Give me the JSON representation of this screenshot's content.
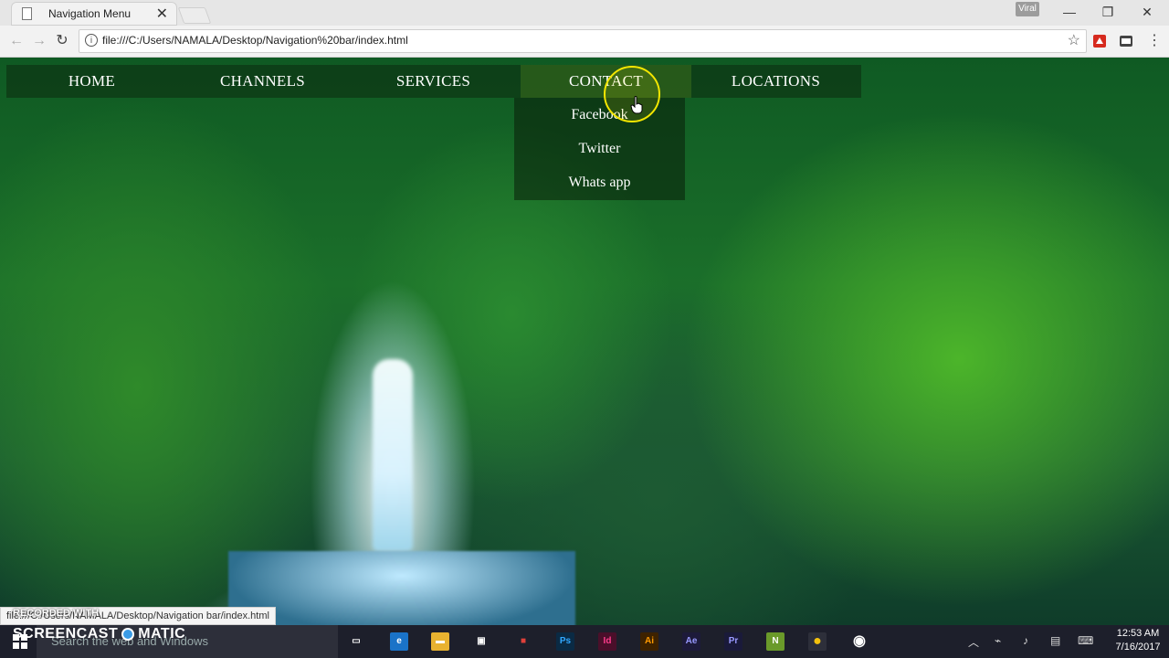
{
  "browser": {
    "tab_title": "Navigation Menu",
    "tab_close": "✕",
    "user_badge": "Viral",
    "url": "file:///C:/Users/NAMALA/Desktop/Navigation%20bar/index.html",
    "status_url": "file:///C:/Users/NAMALA/Desktop/Navigation bar/index.html"
  },
  "nav": {
    "items": [
      {
        "label": "HOME"
      },
      {
        "label": "CHANNELS"
      },
      {
        "label": "SERVICES"
      },
      {
        "label": "CONTACT"
      },
      {
        "label": "LOCATIONS"
      }
    ],
    "active_index": 3,
    "dropdown": [
      {
        "label": "Facebook"
      },
      {
        "label": "Twitter"
      },
      {
        "label": "Whats app"
      }
    ]
  },
  "overlay": {
    "recorded_with": "RECORDED WITH",
    "screencast_left": "SCREENCAST",
    "screencast_right": "MATIC"
  },
  "taskbar": {
    "search_placeholder": "Search the web and Windows",
    "time": "12:53 AM",
    "date": "7/16/2017",
    "apps": [
      {
        "name": "task-view",
        "glyph": "▭",
        "color": "#1d1f2b"
      },
      {
        "name": "edge",
        "glyph": "e",
        "color": "#1a73c8"
      },
      {
        "name": "file-explorer",
        "glyph": "▬",
        "color": "#e8b230"
      },
      {
        "name": "store",
        "glyph": "▣",
        "color": "#1d1f2b"
      },
      {
        "name": "windows-tiles",
        "glyph": "■",
        "color": "#1d1f2b"
      },
      {
        "name": "photoshop",
        "glyph": "Ps",
        "color": "#0a2a44"
      },
      {
        "name": "indesign",
        "glyph": "Id",
        "color": "#4a0f2a"
      },
      {
        "name": "illustrator",
        "glyph": "Ai",
        "color": "#3d2200"
      },
      {
        "name": "after-effects",
        "glyph": "Ae",
        "color": "#1d1a3a"
      },
      {
        "name": "premiere",
        "glyph": "Pr",
        "color": "#1a1a3a"
      },
      {
        "name": "notepad-plus",
        "glyph": "N",
        "color": "#6a9a2a"
      },
      {
        "name": "chrome",
        "glyph": "●",
        "color": "#2d2f3a"
      },
      {
        "name": "screencast-app",
        "glyph": "◉",
        "color": "#1d1f2b"
      }
    ]
  }
}
